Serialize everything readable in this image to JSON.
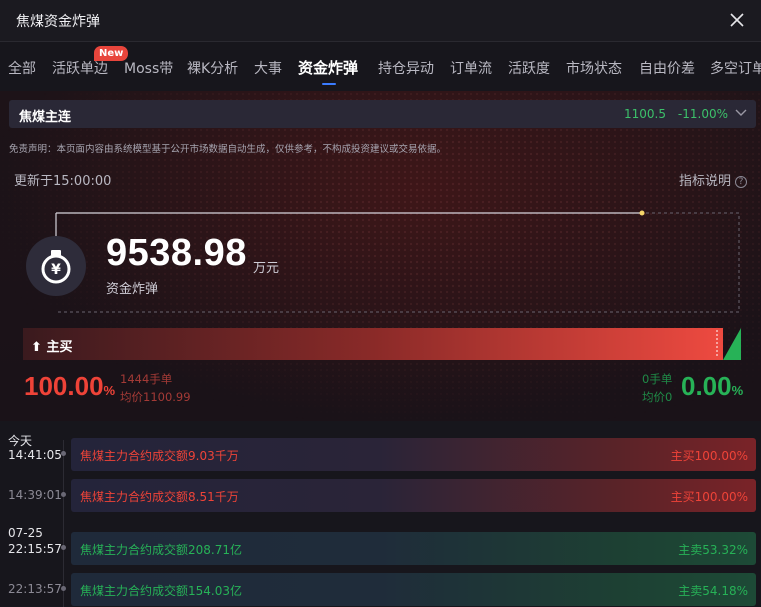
{
  "window": {
    "title": "焦煤资金炸弹"
  },
  "tabs": [
    {
      "label": "全部"
    },
    {
      "label": "活跃单边"
    },
    {
      "label": "Moss带"
    },
    {
      "label": "裸K分析"
    },
    {
      "label": "大事"
    },
    {
      "label": "资金炸弹"
    },
    {
      "label": "持仓异动"
    },
    {
      "label": "订单流"
    },
    {
      "label": "活跃度"
    },
    {
      "label": "市场状态"
    },
    {
      "label": "自由价差"
    },
    {
      "label": "多空订单"
    }
  ],
  "new_badge": "New",
  "active_tab_index": 5,
  "contract": {
    "name": "焦煤主连",
    "price": "1100.5",
    "change": "-11.00%"
  },
  "disclaimer": "免责声明：本页面内容由系统模型基于公开市场数据自动生成，仅供参考，不构成投资建议或交易依据。",
  "updated_label": "更新于15:00:00",
  "indicator_label": "指标说明",
  "indicator_icon": "question-circle-icon",
  "bomb": {
    "icon": "yen-bomb-icon",
    "value": "9538.98",
    "unit": "万元",
    "label": "资金炸弹"
  },
  "flow": {
    "label": "主买",
    "buy_fraction": 1.0,
    "buy_pct": "100.00",
    "buy_lots": "1444手单",
    "buy_avg": "均价1100.99",
    "sell_lots": "0手单",
    "sell_avg": "均价0",
    "sell_pct": "0.00",
    "pct_sign": "%"
  },
  "colors": {
    "up": "#ef4338",
    "down": "#27b257",
    "accent": "#3b7cff"
  },
  "events": [
    {
      "day": "今天",
      "time": "14:41:05",
      "text": "焦煤主力合约成交额9.03千万",
      "value": "主买100.00%",
      "side": "buy"
    },
    {
      "day": "",
      "time": "14:39:01",
      "text": "焦煤主力合约成交额8.51千万",
      "value": "主买100.00%",
      "side": "buy"
    },
    {
      "day": "07-25",
      "time": "22:15:57",
      "text": "焦煤主力合约成交额208.71亿",
      "value": "主卖53.32%",
      "side": "sell"
    },
    {
      "day": "",
      "time": "22:13:57",
      "text": "焦煤主力合约成交额154.03亿",
      "value": "主卖54.18%",
      "side": "sell"
    }
  ]
}
